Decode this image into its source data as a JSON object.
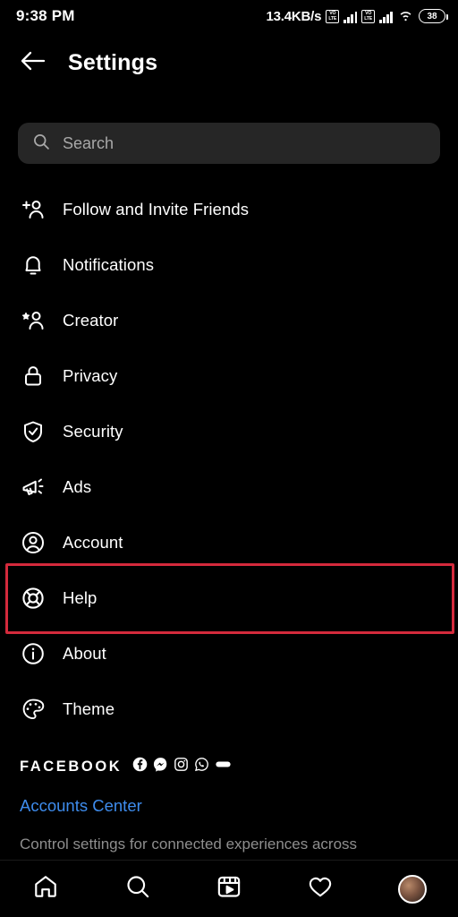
{
  "statusbar": {
    "clock": "9:38 PM",
    "net_speed": "13.4KB/s",
    "sim1_label_top": "VO",
    "sim1_label_bottom": "LTE",
    "sim2_label_top": "VO",
    "sim2_label_bottom": "LTE",
    "battery_level": "38",
    "wifi_icon": "wifi-icon"
  },
  "header": {
    "back_icon": "back-arrow-icon",
    "title": "Settings"
  },
  "search": {
    "icon": "search-icon",
    "placeholder": "Search",
    "value": ""
  },
  "menu": {
    "items": [
      {
        "label": "Follow and Invite Friends",
        "icon": "person-add-icon",
        "highlighted": false
      },
      {
        "label": "Notifications",
        "icon": "bell-icon",
        "highlighted": false
      },
      {
        "label": "Creator",
        "icon": "person-star-icon",
        "highlighted": false
      },
      {
        "label": "Privacy",
        "icon": "lock-icon",
        "highlighted": false
      },
      {
        "label": "Security",
        "icon": "shield-check-icon",
        "highlighted": false
      },
      {
        "label": "Ads",
        "icon": "megaphone-icon",
        "highlighted": false
      },
      {
        "label": "Account",
        "icon": "person-circle-icon",
        "highlighted": false
      },
      {
        "label": "Help",
        "icon": "life-ring-icon",
        "highlighted": true
      },
      {
        "label": "About",
        "icon": "info-circle-icon",
        "highlighted": false
      },
      {
        "label": "Theme",
        "icon": "palette-icon",
        "highlighted": false
      }
    ]
  },
  "facebook_section": {
    "heading": "FACEBOOK",
    "brand_icons": [
      "facebook-icon",
      "messenger-icon",
      "instagram-icon",
      "whatsapp-icon",
      "portal-icon"
    ],
    "link_label": "Accounts Center",
    "description": "Control settings for connected experiences across"
  },
  "bottom_nav": {
    "items": [
      {
        "icon": "home-icon",
        "name": "nav-home"
      },
      {
        "icon": "search-icon",
        "name": "nav-search"
      },
      {
        "icon": "reels-icon",
        "name": "nav-reels"
      },
      {
        "icon": "heart-icon",
        "name": "nav-activity"
      },
      {
        "icon": "avatar-icon",
        "name": "nav-profile"
      }
    ]
  },
  "colors": {
    "background": "#000000",
    "search_field": "#262626",
    "link_blue": "#3e8ced",
    "highlight_red": "#d42a3c",
    "muted_text": "#8e8e8e"
  }
}
